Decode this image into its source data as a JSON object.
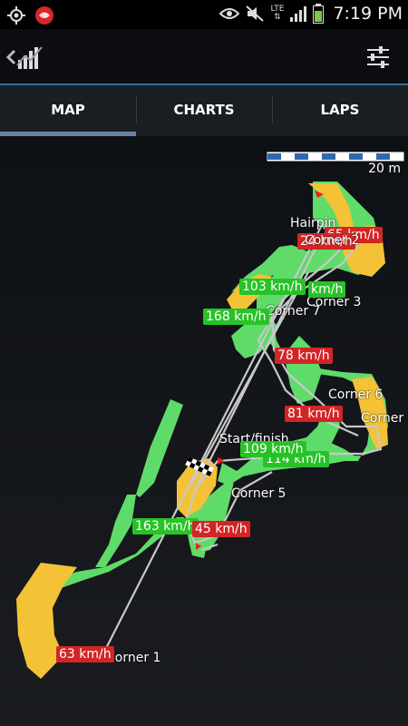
{
  "status_bar": {
    "time": "7:19 PM",
    "network": "LTE",
    "icons": [
      "gps-icon",
      "app-icon",
      "eye-icon",
      "mute-icon",
      "signal-icon",
      "battery-icon"
    ]
  },
  "app_bar": {
    "back_icon": "chevron-left-icon",
    "logo_icon": "chart-logo-icon",
    "settings_icon": "sliders-icon"
  },
  "tabs": [
    {
      "label": "MAP",
      "active": true
    },
    {
      "label": "CHARTS",
      "active": false
    },
    {
      "label": "LAPS",
      "active": false
    }
  ],
  "map": {
    "scale_label": "20 m",
    "corner_labels": {
      "hairpin": "Hairpin",
      "corner2": "Corner 2",
      "corner3": "Corner 3",
      "corner7": "Corner 7",
      "corner6": "Corner 6",
      "corner_partial": "Corner",
      "start_finish": "Start/finish",
      "corner5": "Corner 5",
      "corner1": "Corner 1"
    },
    "speed_labels": {
      "s65": "65 km/h",
      "s24": "24 km/h",
      "s103": "103 km/h",
      "skmh": "km/h",
      "s168": "168 km/h",
      "s78": "78 km/h",
      "s81": "81 km/h",
      "s109": "109 km/h",
      "s114": "114 km/h",
      "s163": "163 km/h",
      "s45": "45 km/h",
      "s63": "63 km/h"
    },
    "colors": {
      "fast": "#5fdb6a",
      "slow": "#f4c236",
      "speed_green": "#28c228",
      "speed_red": "#d22525",
      "route": "#c8c8c8"
    }
  }
}
